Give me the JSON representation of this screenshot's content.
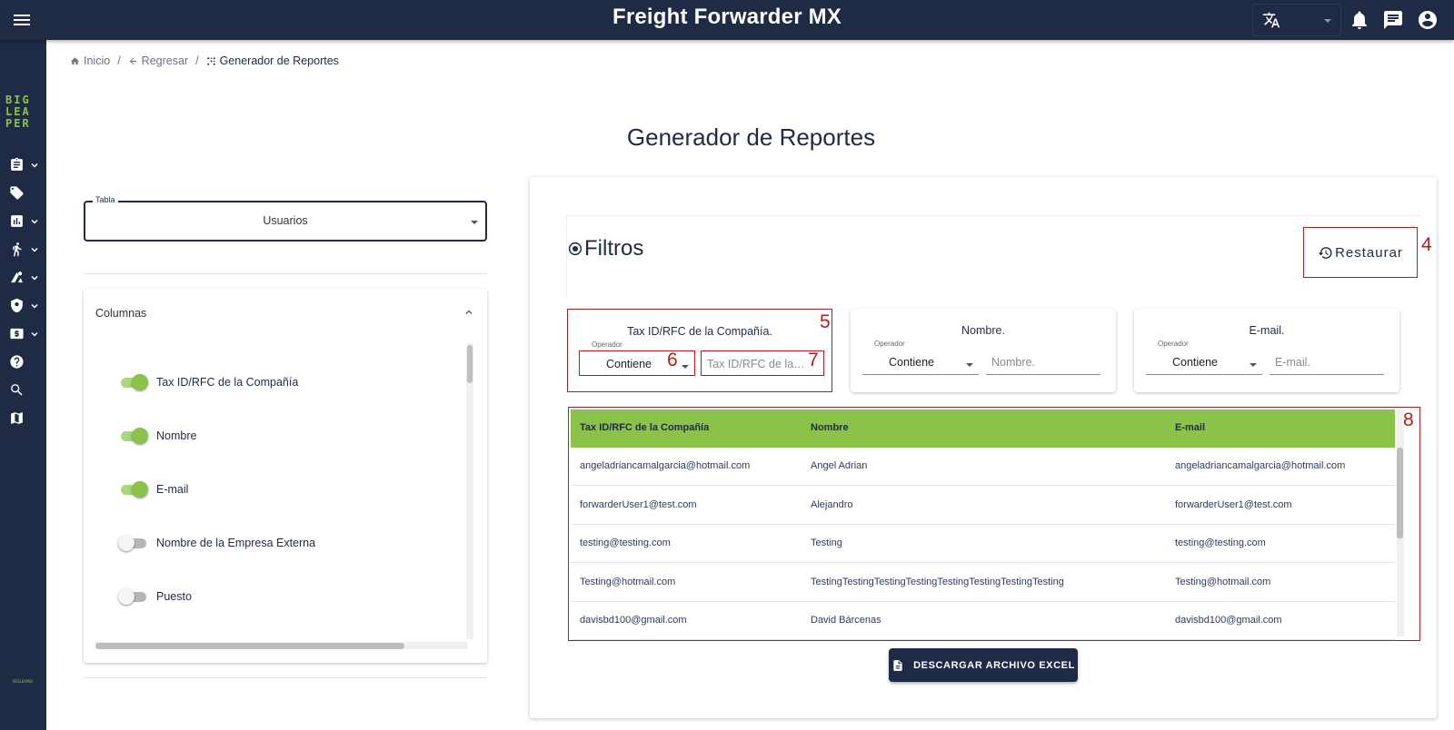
{
  "app": {
    "title": "Freight Forwarder MX",
    "logo_text": "BIG LEA PER",
    "footer_logo_text": "BIGLEAPER"
  },
  "topbar_icons": [
    "menu-icon",
    "translate-icon",
    "bell-icon",
    "chat-icon",
    "account-icon"
  ],
  "sidebar_icons": [
    "clipboard-icon",
    "tag-icon",
    "chart-icon",
    "person-icon",
    "route-icon",
    "shield-icon",
    "money-icon",
    "help-icon",
    "search-icon",
    "map-icon"
  ],
  "breadcrumb": {
    "home": "Inicio",
    "back": "Regresar",
    "current": "Generador de Reportes"
  },
  "page": {
    "title": "Generador de Reportes"
  },
  "tabla": {
    "label": "Tabla",
    "value": "Usuarios"
  },
  "columns": {
    "title": "Columnas",
    "items": [
      {
        "label": "Tax ID/RFC de la Compañía",
        "enabled": true
      },
      {
        "label": "Nombre",
        "enabled": true
      },
      {
        "label": "E-mail",
        "enabled": true
      },
      {
        "label": "Nombre de la Empresa Externa",
        "enabled": false
      },
      {
        "label": "Puesto",
        "enabled": false
      }
    ]
  },
  "filters": {
    "title": "Filtros",
    "restore_label": "Restaurar",
    "operator_label": "Operador",
    "cards": [
      {
        "title": "Tax ID/RFC de la Compañía.",
        "operator": "Contiene",
        "placeholder": "Tax ID/RFC de la Compañía."
      },
      {
        "title": "Nombre.",
        "operator": "Contiene",
        "placeholder": "Nombre."
      },
      {
        "title": "E-mail.",
        "operator": "Contiene",
        "placeholder": "E-mail."
      }
    ]
  },
  "annotations": {
    "restore": "4",
    "filter_card": "5",
    "operator_select": "6",
    "filter_input": "7",
    "table": "8"
  },
  "table": {
    "headers": [
      "Tax ID/RFC de la Compañía",
      "Nombre",
      "E-mail"
    ],
    "header_color": "#8bc34a",
    "rows": [
      [
        "angeladriancamalgarcia@hotmail.com",
        "Angel Adrian",
        "angeladriancamalgarcia@hotmail.com"
      ],
      [
        "forwarderUser1@test.com",
        "Alejandro",
        "forwarderUser1@test.com"
      ],
      [
        "testing@testing.com",
        "Testing",
        "testing@testing.com"
      ],
      [
        "Testing@hotmail.com",
        "TestingTestingTestingTestingTestingTestingTestingTesting",
        "Testing@hotmail.com"
      ],
      [
        "davisbd100@gmail.com",
        "David Bárcenas",
        "davisbd100@gmail.com"
      ]
    ]
  },
  "download": {
    "label": "DESCARGAR ARCHIVO EXCEL"
  },
  "colors": {
    "navy": "#1f2a44",
    "accent_green": "#8bc34a",
    "annotation_red": "#b71c1c"
  }
}
